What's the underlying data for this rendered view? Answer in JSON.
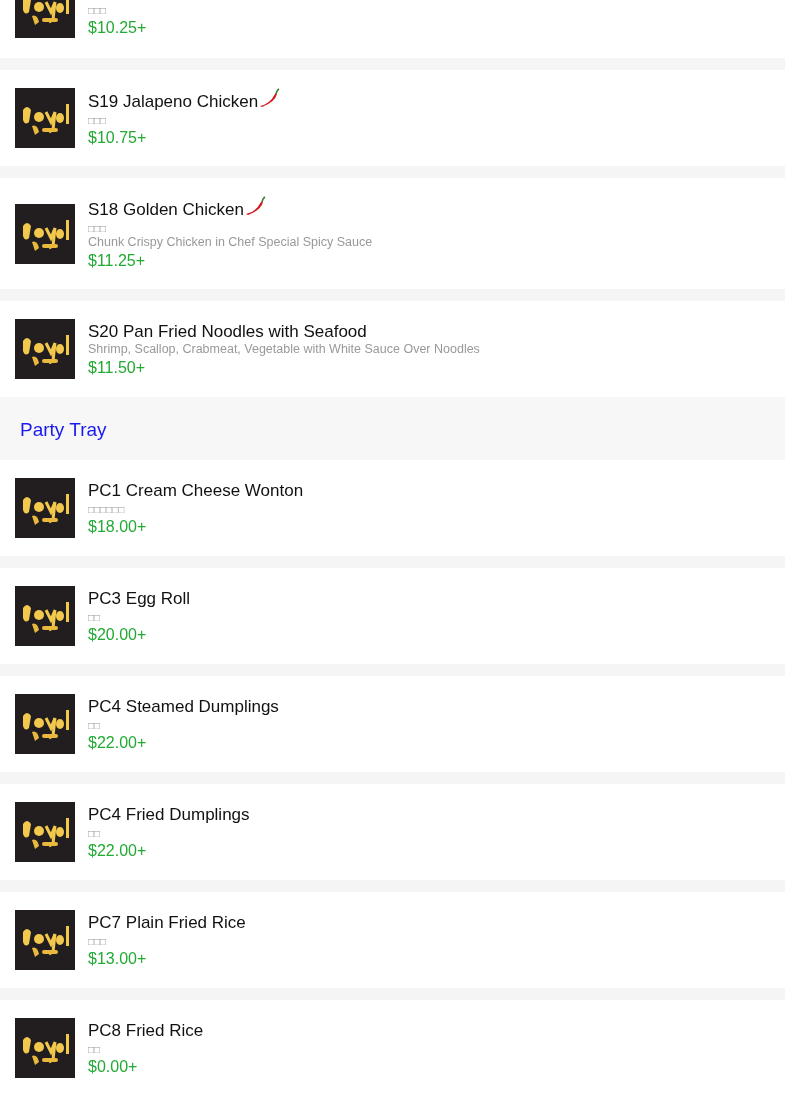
{
  "sections": [
    {
      "items": [
        {
          "subtitle": "□□□",
          "price": "$10.25+",
          "spicy": false
        },
        {
          "name": "S19 Jalapeno Chicken",
          "subtitle": "□□□",
          "price": "$10.75+",
          "spicy": true
        },
        {
          "name": "S18 Golden Chicken",
          "subtitle": "□□□",
          "description": "Chunk Crispy Chicken in Chef Special Spicy Sauce",
          "price": "$11.25+",
          "spicy": true
        },
        {
          "name": "S20 Pan Fried Noodles with Seafood",
          "description": "Shrimp, Scallop, Crabmeat, Vegetable with White Sauce Over Noodles",
          "price": "$11.50+",
          "spicy": false
        }
      ]
    },
    {
      "title": "Party Tray",
      "items": [
        {
          "name": "PC1 Cream Cheese Wonton",
          "subtitle": "□□□□□□",
          "price": "$18.00+",
          "spicy": false
        },
        {
          "name": "PC3 Egg Roll",
          "subtitle": "□□",
          "price": "$20.00+",
          "spicy": false
        },
        {
          "name": "PC4 Steamed Dumplings",
          "subtitle": "□□",
          "price": "$22.00+",
          "spicy": false
        },
        {
          "name": "PC4 Fried Dumplings",
          "subtitle": "□□",
          "price": "$22.00+",
          "spicy": false
        },
        {
          "name": "PC7 Plain Fried Rice",
          "subtitle": "□□□",
          "price": "$13.00+",
          "spicy": false
        },
        {
          "name": "PC8 Fried Rice",
          "subtitle": "□□",
          "price": "$0.00+",
          "spicy": false
        }
      ]
    }
  ]
}
